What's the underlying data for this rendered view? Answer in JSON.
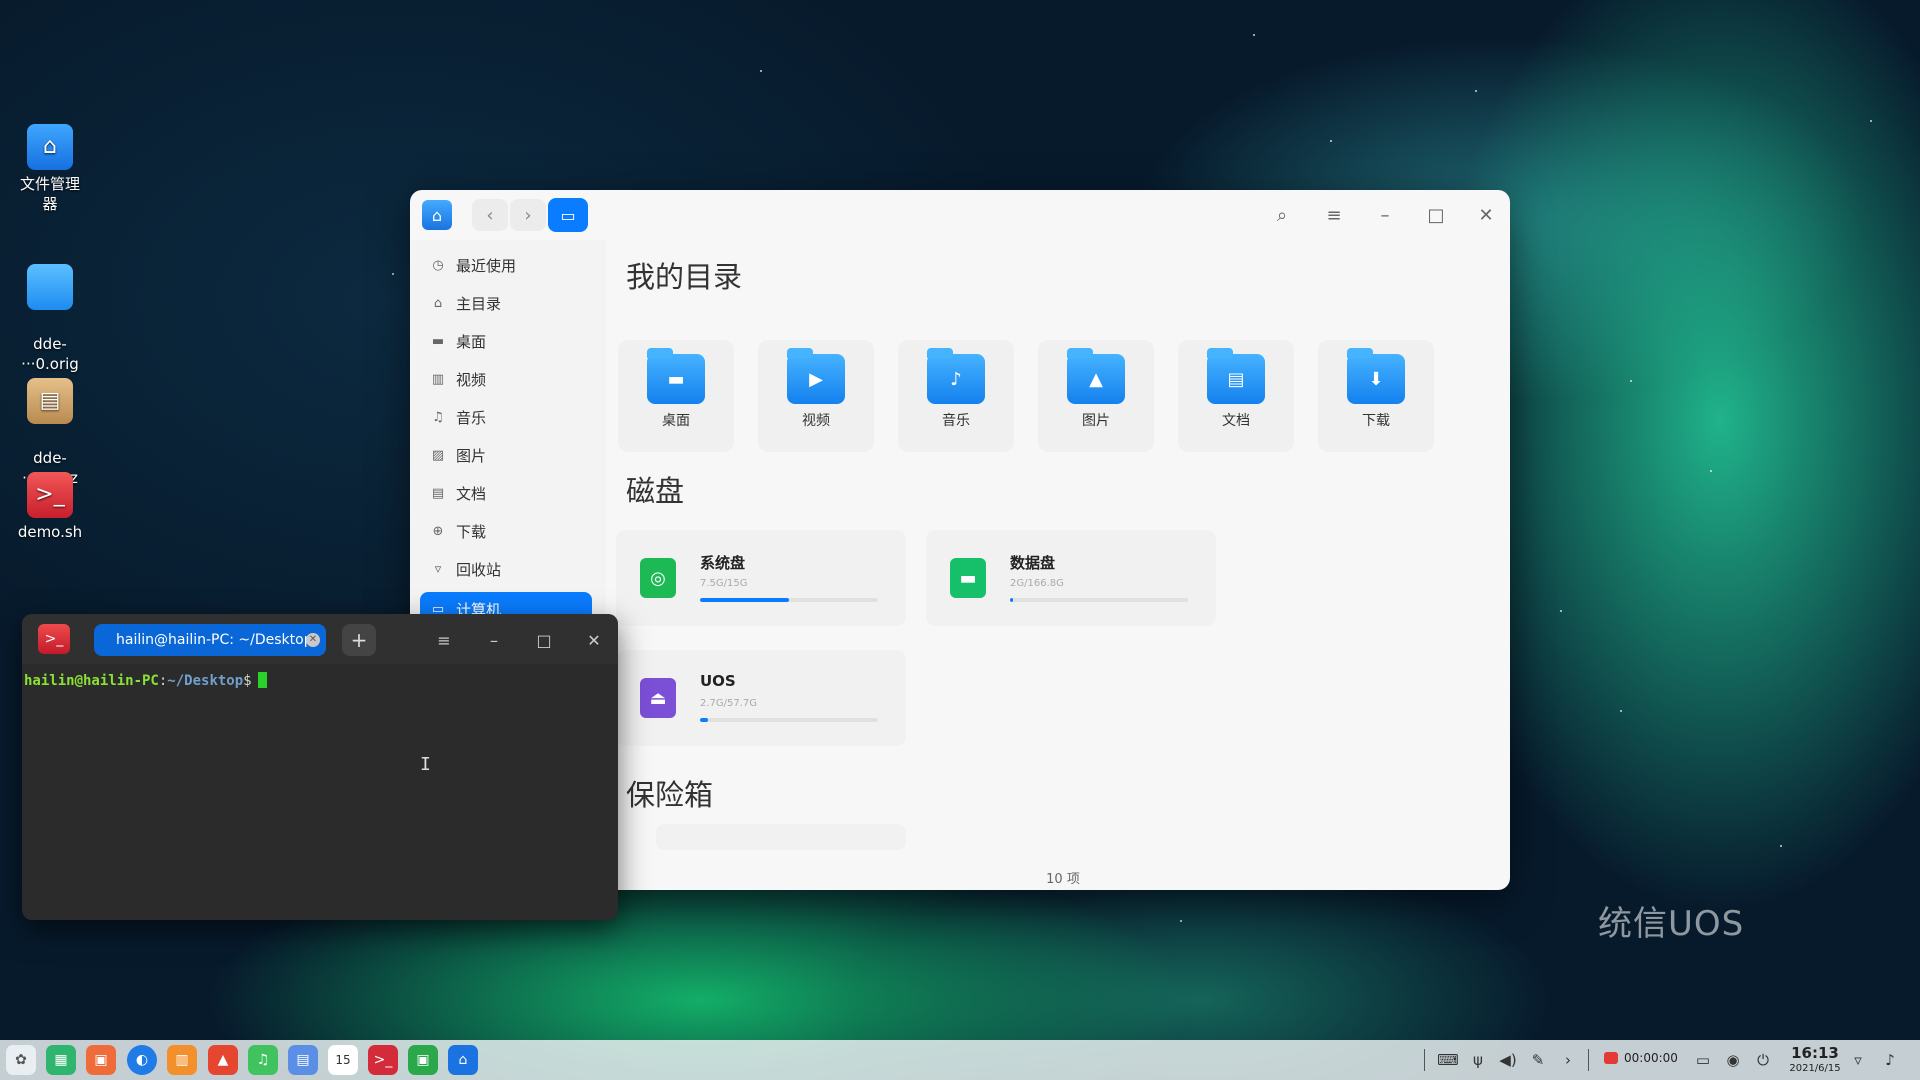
{
  "desktop": {
    "icons": [
      {
        "label": "文件管理器",
        "icon": "file-manager-icon"
      },
      {
        "label": "dde-\n···0.orig",
        "icon": "folder-icon"
      },
      {
        "label": "dde-\n···tar.xz",
        "icon": "archive-icon"
      },
      {
        "label": "demo.sh",
        "icon": "shell-script-icon"
      }
    ],
    "watermark": "统信UOS"
  },
  "file_manager": {
    "sidebar": [
      {
        "label": "最近使用",
        "icon": "clock-icon"
      },
      {
        "label": "主目录",
        "icon": "home-icon"
      },
      {
        "label": "桌面",
        "icon": "desktop-icon"
      },
      {
        "label": "视频",
        "icon": "video-icon"
      },
      {
        "label": "音乐",
        "icon": "music-icon"
      },
      {
        "label": "图片",
        "icon": "picture-icon"
      },
      {
        "label": "文档",
        "icon": "document-icon"
      },
      {
        "label": "下载",
        "icon": "download-icon"
      },
      {
        "label": "回收站",
        "icon": "trash-icon"
      },
      {
        "label": "计算机",
        "icon": "computer-icon",
        "active": true
      }
    ],
    "my_dirs_title": "我的目录",
    "dirs": [
      {
        "label": "桌面",
        "icon": "desktop-folder-icon"
      },
      {
        "label": "视频",
        "icon": "video-folder-icon"
      },
      {
        "label": "音乐",
        "icon": "music-folder-icon"
      },
      {
        "label": "图片",
        "icon": "picture-folder-icon"
      },
      {
        "label": "文档",
        "icon": "document-folder-icon"
      },
      {
        "label": "下载",
        "icon": "download-folder-icon"
      }
    ],
    "disks_title": "磁盘",
    "disks": [
      {
        "name": "系统盘",
        "size": "7.5G/15G",
        "usage": 0.5,
        "color": "#1db954"
      },
      {
        "name": "数据盘",
        "size": "2G/166.8G",
        "usage": 0.012,
        "color": "#16c06a"
      },
      {
        "name": "UOS",
        "size": "2.7G/57.7G",
        "usage": 0.047,
        "color": "#7b4fd6"
      }
    ],
    "vault_title": "保险箱",
    "status": "10 项"
  },
  "terminal": {
    "tab_title": "hailin@hailin-PC: ~/Desktop",
    "prompt_user": "hailin@hailin-PC",
    "prompt_sep": ":",
    "prompt_path": "~/Desktop",
    "prompt_symbol": "$"
  },
  "taskbar": {
    "record_time": "00:00:00",
    "time": "16:13",
    "date": "2021/6/15"
  },
  "colors": {
    "accent": "#0a7cff"
  }
}
